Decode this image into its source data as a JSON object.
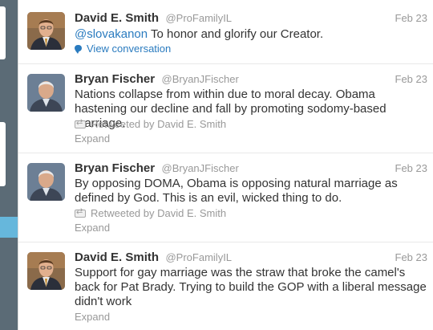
{
  "tweets": [
    {
      "avatar": "avatar-david-smith",
      "fullname": "David E. Smith",
      "username": "@ProFamilyIL",
      "date": "Feb 23",
      "mention": "@slovakanon",
      "text": " To honor and glorify our Creator.",
      "action": "View conversation",
      "action_icon": "speech-bubble-icon"
    },
    {
      "avatar": "avatar-bryan-fischer",
      "fullname": "Bryan Fischer",
      "username": "@BryanJFischer",
      "date": "Feb 23",
      "text": "Nations collapse from within due to moral decay. Obama hastening our decline and fall by promoting sodomy-based marriage.",
      "retweeted_by": "Retweeted by David E. Smith",
      "retweet_icon": "retweet-icon",
      "action": "Expand"
    },
    {
      "avatar": "avatar-bryan-fischer",
      "fullname": "Bryan Fischer",
      "username": "@BryanJFischer",
      "date": "Feb 23",
      "text": "By opposing DOMA, Obama is opposing natural marriage as defined by God. This is an evil, wicked thing to do.",
      "retweeted_by": "Retweeted by David E. Smith",
      "retweet_icon": "retweet-icon",
      "action": "Expand"
    },
    {
      "avatar": "avatar-david-smith",
      "fullname": "David E. Smith",
      "username": "@ProFamilyIL",
      "date": "Feb 23",
      "text": "Support for gay marriage was the straw that broke the camel's back for Pat Brady. Trying to build the GOP with a liberal message didn't work",
      "action": "Expand"
    }
  ]
}
